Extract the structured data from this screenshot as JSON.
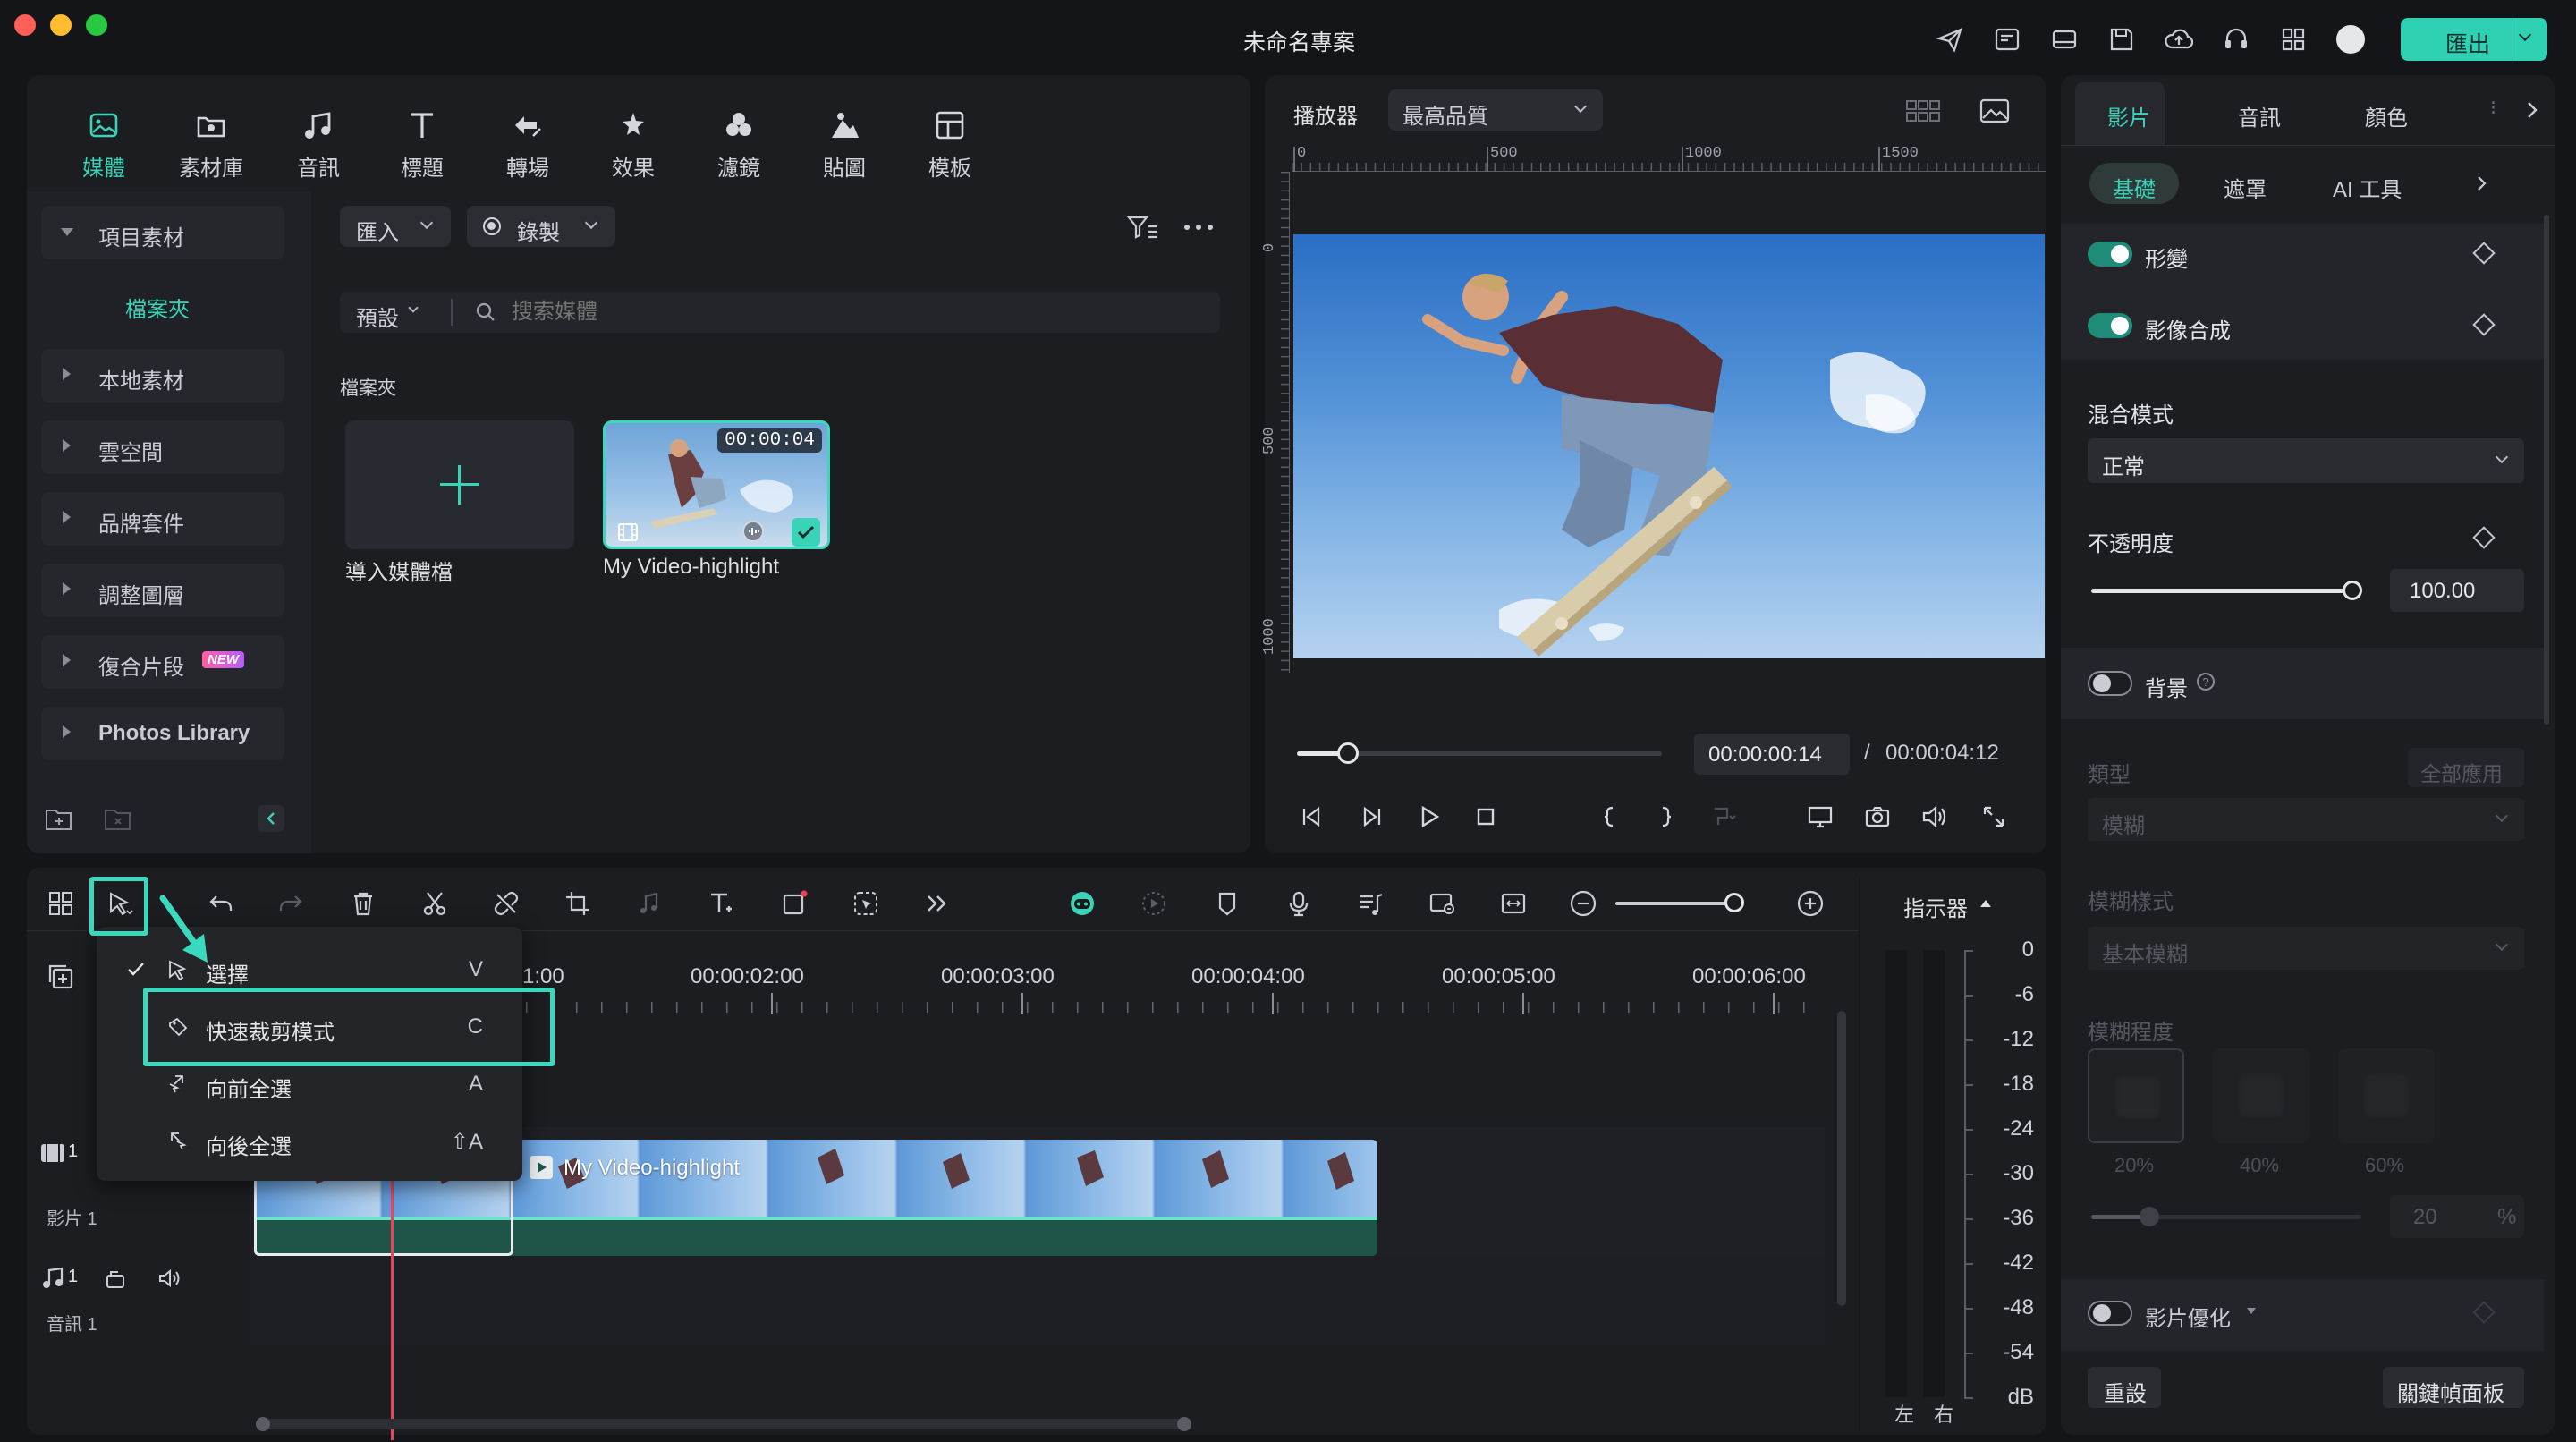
{
  "window": {
    "title": "未命名專案",
    "export_label": "匯出"
  },
  "toolbar_tabs": [
    {
      "label": "媒體",
      "icon": "media-icon",
      "active": true
    },
    {
      "label": "素材庫",
      "icon": "stock-media-icon"
    },
    {
      "label": "音訊",
      "icon": "music-note-icon"
    },
    {
      "label": "標題",
      "icon": "title-text-icon"
    },
    {
      "label": "轉場",
      "icon": "transition-icon"
    },
    {
      "label": "效果",
      "icon": "effects-icon"
    },
    {
      "label": "濾鏡",
      "icon": "filters-icon"
    },
    {
      "label": "貼圖",
      "icon": "stickers-icon"
    },
    {
      "label": "模板",
      "icon": "templates-icon"
    }
  ],
  "sidebar": {
    "project_media": "項目素材",
    "folder": "檔案夾",
    "items": [
      {
        "label": "本地素材"
      },
      {
        "label": "雲空間"
      },
      {
        "label": "品牌套件"
      },
      {
        "label": "調整圖層"
      },
      {
        "label": "復合片段",
        "badge": "NEW"
      },
      {
        "label": "Photos Library"
      }
    ]
  },
  "media": {
    "import_label": "匯入",
    "record_label": "錄製",
    "preset_label": "預設",
    "search_placeholder": "搜索媒體",
    "folder_heading": "檔案夾",
    "import_tile_label": "導入媒體檔",
    "clip": {
      "name": "My Video-highlight",
      "duration": "00:00:04"
    }
  },
  "player": {
    "label": "播放器",
    "quality": "最高品質",
    "ruler_top": [
      "0",
      "500",
      "1000",
      "1500"
    ],
    "ruler_left": [
      "0",
      "500",
      "1000"
    ],
    "current_time": "00:00:00:14",
    "separator": "/",
    "total_time": "00:00:04:12",
    "progress": 0.14
  },
  "inspector": {
    "main_tabs": [
      "影片",
      "音訊",
      "顏色"
    ],
    "sub_tabs": [
      "基礎",
      "遮罩",
      "AI 工具"
    ],
    "transform": "形變",
    "compositing": "影像合成",
    "blend_mode_label": "混合模式",
    "blend_mode_value": "正常",
    "opacity_label": "不透明度",
    "opacity_value": "100.00",
    "opacity_level": 1.0,
    "background_label": "背景",
    "type_label": "類型",
    "apply_all": "全部應用",
    "type_value": "模糊",
    "blur_style_label": "模糊樣式",
    "blur_style_value": "基本模糊",
    "blur_level_label": "模糊程度",
    "blur_presets": [
      "20%",
      "40%",
      "60%"
    ],
    "blur_value": "20",
    "blur_unit": "%",
    "enhance_label": "影片優化",
    "reset_label": "重設",
    "keyframe_panel_label": "關鍵幀面板"
  },
  "timeline": {
    "meter_label": "指示器",
    "ruler": [
      "1:00",
      "00:00:02:00",
      "00:00:03:00",
      "00:00:04:00",
      "00:00:05:00",
      "00:00:06:00"
    ],
    "video_track_label": "影片 1",
    "audio_track_label": "音訊 1",
    "video_track_num": "1",
    "audio_track_num": "1",
    "clip_name": "My Video-highlight",
    "meter_scale": [
      "0",
      "-6",
      "-12",
      "-18",
      "-24",
      "-30",
      "-36",
      "-42",
      "-48",
      "-54",
      "dB"
    ],
    "meter_channels": [
      "左",
      "右"
    ]
  },
  "select_menu": {
    "items": [
      {
        "label": "選擇",
        "shortcut": "V",
        "checked": true,
        "icon": "pointer-icon"
      },
      {
        "label": "快速裁剪模式",
        "shortcut": "C",
        "highlighted": true,
        "icon": "blade-icon"
      },
      {
        "label": "向前全選",
        "shortcut": "A",
        "icon": "select-forward-icon"
      },
      {
        "label": "向後全選",
        "shortcut": "⇧A",
        "icon": "select-backward-icon"
      }
    ]
  },
  "colors": {
    "accent": "#39d3b7",
    "highlight_border": "#3ad8bd",
    "playhead": "#e8455a"
  }
}
